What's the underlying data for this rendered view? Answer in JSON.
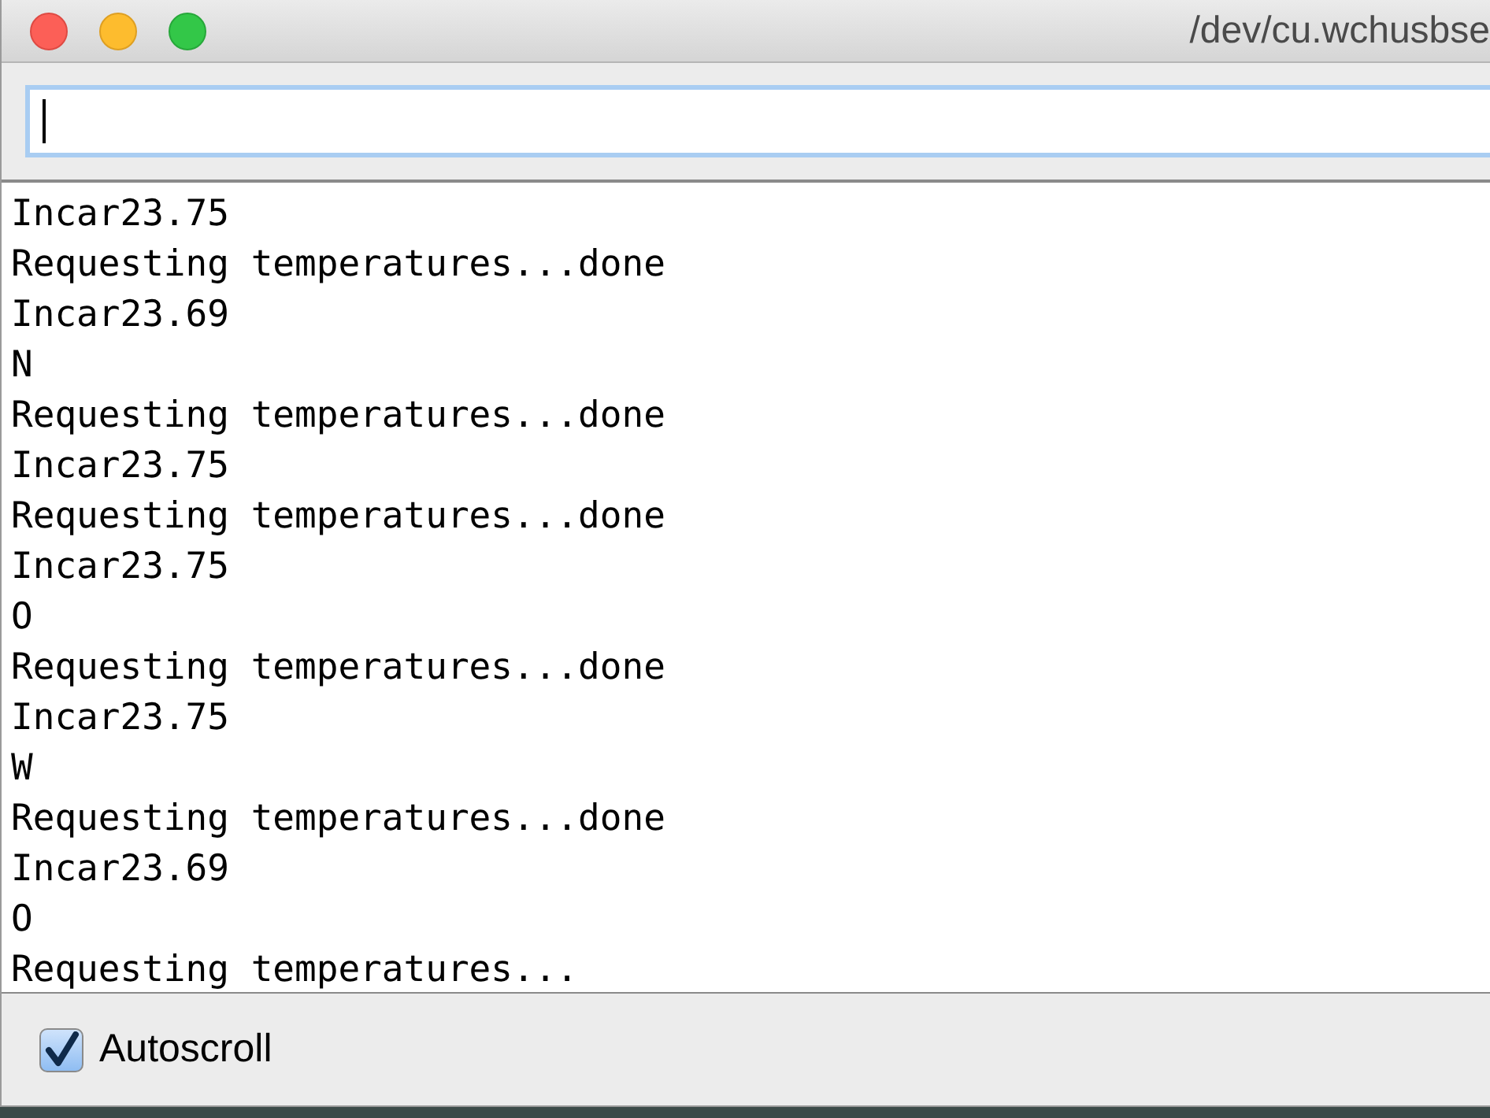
{
  "window": {
    "title": "/dev/cu.wchusbse"
  },
  "output": {
    "lines": [
      "Incar23.75",
      "Requesting temperatures...done",
      "Incar23.69",
      "N",
      "Requesting temperatures...done",
      "Incar23.75",
      "Requesting temperatures...done",
      "Incar23.75",
      "O",
      "Requesting temperatures...done",
      "Incar23.75",
      "W",
      "Requesting temperatures...done",
      "Incar23.69",
      "O",
      "Requesting temperatures..."
    ]
  },
  "autoscroll": {
    "label": "Autoscroll",
    "checked": true
  }
}
